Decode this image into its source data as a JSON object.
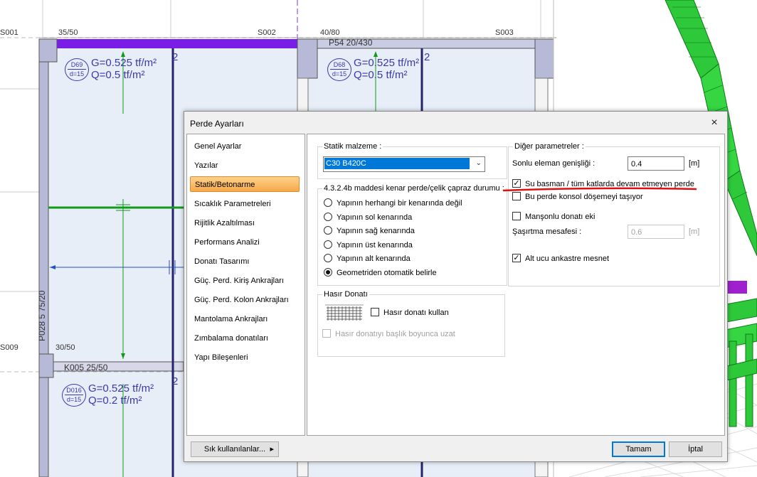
{
  "cad": {
    "axis_labels": [
      "S001",
      "S002",
      "S003",
      "S009"
    ],
    "section_labels": [
      "35/50",
      "40/80",
      "30/50"
    ],
    "beam_labels": [
      "P54 20/430",
      "K005 25/50"
    ],
    "column_label": "P028 5 75/20",
    "slabs": [
      {
        "id": "D69",
        "d": "d=15",
        "g": "G=0.525 tf/m²",
        "q": "Q=0.5 tf/m²",
        "mark": "2"
      },
      {
        "id": "D68",
        "d": "d=15",
        "g": "G=0.525 tf/m²",
        "q": "Q=0.5 tf/m²",
        "mark": "2"
      },
      {
        "id": "D016",
        "d": "d=15",
        "g": "G=0.525 tf/m²",
        "q": "Q=0.2 tf/m²",
        "mark": "2"
      }
    ]
  },
  "dialog": {
    "title": "Perde Ayarları",
    "close_icon": "×",
    "nav": [
      "Genel Ayarlar",
      "Yazılar",
      "Statik/Betonarme",
      "Sıcaklık Parametreleri",
      "Rijitlik Azaltılması",
      "Performans Analizi",
      "Donatı Tasarımı",
      "Güç. Perd. Kiriş Ankrajları",
      "Güç. Perd. Kolon Ankrajları",
      "Mantolama Ankrajları",
      "Zımbalama donatıları",
      "Yapı Bileşenleri"
    ],
    "selected_nav": "Statik/Betonarme",
    "static_material": {
      "label": "Statik malzeme :",
      "value": "C30 B420C"
    },
    "edge": {
      "label": "4.3.2.4b maddesi kenar perde/çelik çapraz durumu :",
      "options": [
        "Yapının herhangi bir kenarında değil",
        "Yapının sol kenarında",
        "Yapının sağ kenarında",
        "Yapının üst kenarında",
        "Yapının alt kenarında",
        "Geometriden otomatik belirle"
      ],
      "selected": "Geometriden otomatik belirle"
    },
    "mesh": {
      "label": "Hasır Donatı",
      "use_label": "Hasır donatı kullan",
      "extend_label": "Hasır donatıyı başlık boyunca uzat"
    },
    "other": {
      "label": "Diğer parametreler :",
      "fe_width_label": "Sonlu eleman genişliği :",
      "fe_width_value": "0.4",
      "fe_width_unit": "[m]",
      "basement_label": "Su basman / tüm katlarda devam etmeyen perde",
      "basement_checked": "✓",
      "cantilever_label": "Bu perde konsol döşemeyi taşıyor",
      "sleeve_label": "Manşonlu donatı eki",
      "offset_label": "Şaşırtma mesafesi :",
      "offset_value": "0.6",
      "offset_unit": "[m]",
      "fixed_label": "Alt ucu ankastre mesnet",
      "fixed_checked": "✓"
    },
    "buttons": {
      "favorites": "Sık kullanılanlar...",
      "favorites_arrow": "▸",
      "ok": "Tamam",
      "cancel": "İptal"
    },
    "colors": {
      "selection": "#0078d7",
      "nav_selected": "#f6a94a",
      "annotation": "#dd1111"
    }
  }
}
